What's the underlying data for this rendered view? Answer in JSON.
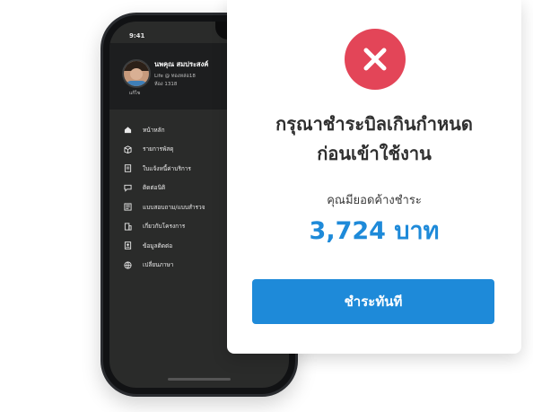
{
  "phone": {
    "status_time": "9:41",
    "profile": {
      "name": "นพคุณ สมประสงค์",
      "line1": "Life @ ทองหล่อ18",
      "line2": "ห้อง 1318",
      "tag": "แก้ไข"
    },
    "menu": [
      {
        "label": "หน้าหลัก",
        "icon": "home-icon"
      },
      {
        "label": "รายการพัสดุ",
        "icon": "parcel-icon"
      },
      {
        "label": "ใบแจ้งหนี้ค่าบริการ",
        "icon": "invoice-icon"
      },
      {
        "label": "ติดต่อนิติ",
        "icon": "chat-icon"
      },
      {
        "label": "แบบสอบถาม/แบบสำรวจ",
        "icon": "survey-icon"
      },
      {
        "label": "เกี่ยวกับโครงการ",
        "icon": "building-icon"
      },
      {
        "label": "ข้อมูลติดต่อ",
        "icon": "contact-icon"
      },
      {
        "label": "เปลี่ยนภาษา",
        "icon": "globe-icon"
      }
    ]
  },
  "dialog": {
    "icon": "close-icon",
    "title_line1": "กรุณาชำระบิลเกินกำหนด",
    "title_line2": "ก่อนเข้าใช้งาน",
    "amount_label": "คุณมียอดค้างชำระ",
    "amount": "3,724 บาท",
    "pay_button": "ชำระทันที"
  },
  "colors": {
    "accent": "#1e8ad9",
    "error": "#e34558",
    "phone_screen": "#2a2b2a"
  }
}
